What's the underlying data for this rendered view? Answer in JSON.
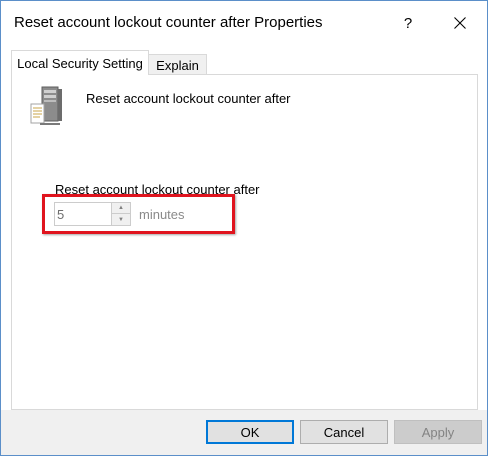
{
  "window": {
    "title": "Reset account lockout counter after Properties",
    "help_label": "?",
    "accent_color": "#0078d7"
  },
  "tabs": [
    {
      "label": "Local Security Setting",
      "selected": true
    },
    {
      "label": "Explain",
      "selected": false
    }
  ],
  "panel": {
    "policy_icon": "server-policy-icon",
    "heading": "Reset account lockout counter after",
    "field_label": "Reset account lockout counter after",
    "field_value": "5",
    "unit_label": "minutes",
    "spin_up_icon": "chevron-up-icon",
    "spin_down_icon": "chevron-down-icon",
    "highlight_color": "#e0141e"
  },
  "buttons": {
    "ok": "OK",
    "cancel": "Cancel",
    "apply": "Apply"
  }
}
